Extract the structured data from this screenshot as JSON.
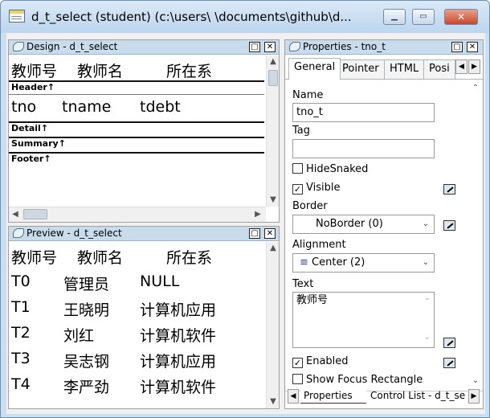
{
  "window": {
    "title": "d_t_select  (student) (c:\\users\\        \\documents\\github\\d..."
  },
  "design": {
    "title": "Design - d_t_select",
    "header_labels": [
      "教师号",
      "教师名",
      "所在系"
    ],
    "header_band": "Header↑",
    "detail_fields": [
      "tno",
      "tname",
      "tdebt"
    ],
    "detail_band": "Detail↑",
    "summary_band": "Summary↑",
    "footer_band": "Footer↑"
  },
  "preview": {
    "title": "Preview - d_t_select",
    "columns": [
      "教师号",
      "教师名",
      "所在系"
    ],
    "rows": [
      [
        "T0",
        "管理员",
        "NULL"
      ],
      [
        "T1",
        "王晓明",
        "计算机应用"
      ],
      [
        "T2",
        "刘红",
        "计算机软件"
      ],
      [
        "T3",
        "吴志钢",
        "计算机应用"
      ],
      [
        "T4",
        "李严劲",
        "计算机软件"
      ]
    ]
  },
  "properties": {
    "title": "Properties -  tno_t",
    "tabs": [
      "General",
      "Pointer",
      "HTML",
      "Posi"
    ],
    "name_label": "Name",
    "name_value": "tno_t",
    "tag_label": "Tag",
    "tag_value": "",
    "hidesnaked_label": "HideSnaked",
    "visible_label": "Visible",
    "border_label": "Border",
    "border_value": "NoBorder (0)",
    "alignment_label": "Alignment",
    "alignment_value": "Center (2)",
    "text_label": "Text",
    "text_value": "教师号",
    "enabled_label": "Enabled",
    "showfocus_label": "Show Focus Rectangle",
    "bottom_tabs": [
      "Properties",
      "Control List - d_t_se"
    ]
  }
}
